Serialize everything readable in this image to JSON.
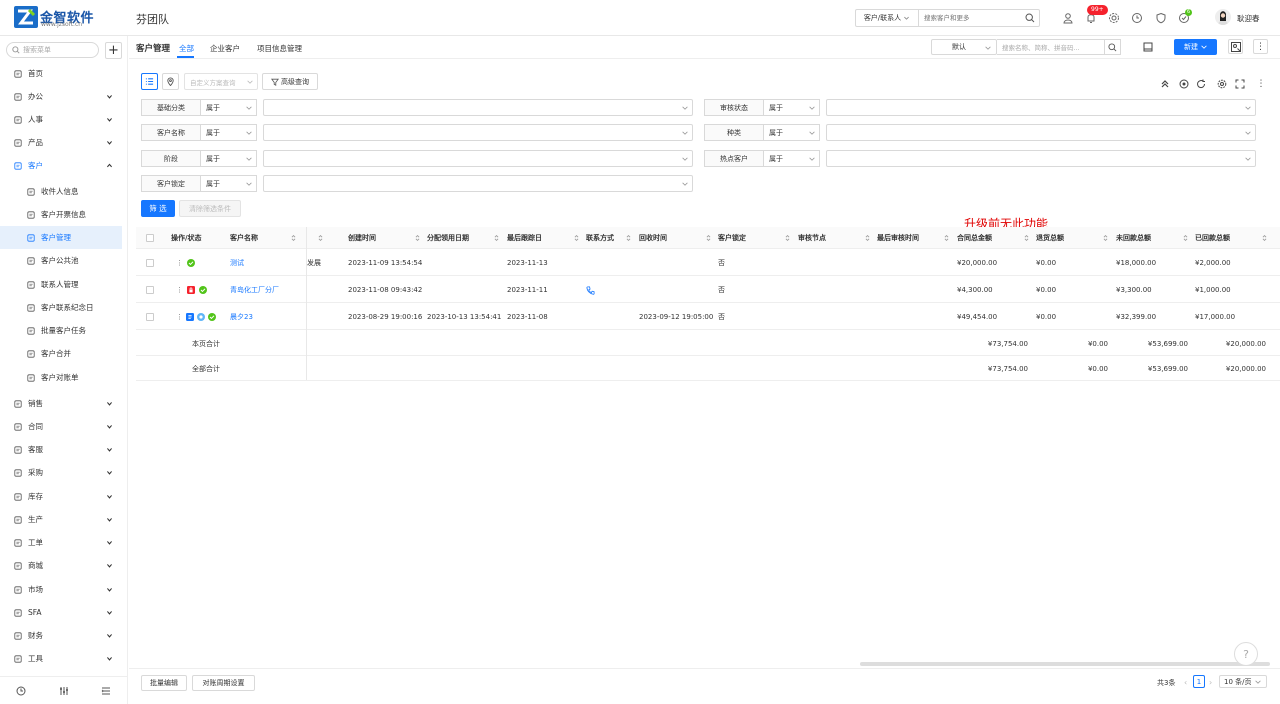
{
  "header": {
    "brand": "金智软件",
    "brand_url": "www.jzsoft.cn",
    "team": "芬团队",
    "search_scope": "客户/联系人",
    "search_placeholder": "搜索客户和更多",
    "notif_badge": "99+",
    "small_badge": "6",
    "user_name": "耿迎春"
  },
  "sidebar": {
    "search_placeholder": "搜索菜单",
    "items": [
      {
        "label": "首页",
        "icon": "home-icon"
      },
      {
        "label": "办公",
        "icon": "office-icon"
      },
      {
        "label": "人事",
        "icon": "person-icon"
      },
      {
        "label": "产品",
        "icon": "product-icon"
      },
      {
        "label": "客户",
        "icon": "customer-icon"
      },
      {
        "label": "收件人信息",
        "icon": "recipient-icon"
      },
      {
        "label": "客户开票信息",
        "icon": "invoice-icon"
      },
      {
        "label": "客户管理",
        "icon": "customer-manage-icon"
      },
      {
        "label": "客户公共池",
        "icon": "pool-icon"
      },
      {
        "label": "联系人管理",
        "icon": "contact-icon"
      },
      {
        "label": "客户联系纪念日",
        "icon": "calendar-icon"
      },
      {
        "label": "批量客户任务",
        "icon": "batch-task-icon"
      },
      {
        "label": "客户合并",
        "icon": "merge-icon"
      },
      {
        "label": "客户对账单",
        "icon": "statement-icon"
      },
      {
        "label": "销售",
        "icon": "sales-icon"
      },
      {
        "label": "合同",
        "icon": "contract-icon"
      },
      {
        "label": "客服",
        "icon": "service-icon"
      },
      {
        "label": "采购",
        "icon": "purchase-icon"
      },
      {
        "label": "库存",
        "icon": "stock-icon"
      },
      {
        "label": "生产",
        "icon": "production-icon"
      },
      {
        "label": "工单",
        "icon": "ticket-icon"
      },
      {
        "label": "商城",
        "icon": "mall-icon"
      },
      {
        "label": "市场",
        "icon": "market-icon"
      },
      {
        "label": "SFA",
        "icon": "sfa-icon"
      },
      {
        "label": "财务",
        "icon": "finance-icon"
      },
      {
        "label": "工具",
        "icon": "tools-icon"
      }
    ]
  },
  "subheader": {
    "title": "客户管理",
    "tabs": [
      "全部",
      "企业客户",
      "项目信息管理"
    ],
    "view": "默认",
    "keyword_placeholder": "搜索名称、简称、拼音码...",
    "new_label": "新建"
  },
  "filters": {
    "plan_placeholder": "自定义方案查询",
    "advanced_label": "高级查询",
    "rows": [
      {
        "label": "基础分类",
        "op": "属于"
      },
      {
        "label": "审核状态",
        "op": "属于"
      },
      {
        "label": "客户名称",
        "op": "属于"
      },
      {
        "label": "种类",
        "op": "属于"
      },
      {
        "label": "阶段",
        "op": "属于"
      },
      {
        "label": "热点客户",
        "op": "属于"
      },
      {
        "label": "客户锁定",
        "op": "属于"
      }
    ],
    "filter_btn": "筛 选",
    "clear_btn": "清除筛选条件"
  },
  "upgrade_note": "升级前无此功能",
  "table": {
    "columns": [
      "操作/状态",
      "客户名称",
      "创建时间",
      "分配领用日期",
      "最后跟踪日",
      "联系方式",
      "回收时间",
      "客户锁定",
      "审核节点",
      "最后审核时间",
      "合同总金额",
      "退货总额",
      "未回款总额",
      "已回款总额"
    ],
    "rows": [
      {
        "name": "测试",
        "partial": "发展",
        "created": "2023-11-09 13:54:54",
        "assigned": "",
        "last_track": "2023-11-13",
        "recycle": "",
        "locked": "否",
        "contract": "¥20,000.00",
        "returns": "¥0.00",
        "unpaid": "¥18,000.00",
        "paid": "¥2,000.00"
      },
      {
        "name": "青岛化工厂分厂",
        "partial": "",
        "created": "2023-11-08 09:43:42",
        "assigned": "",
        "last_track": "2023-11-11",
        "recycle": "",
        "locked": "否",
        "contract": "¥4,300.00",
        "returns": "¥0.00",
        "unpaid": "¥3,300.00",
        "paid": "¥1,000.00"
      },
      {
        "name": "晨夕23",
        "partial": "",
        "created": "2023-08-29 19:00:16",
        "assigned": "2023-10-13 13:54:41",
        "last_track": "2023-11-08",
        "recycle": "2023-09-12 19:05:00",
        "locked": "否",
        "contract": "¥49,454.00",
        "returns": "¥0.00",
        "unpaid": "¥32,399.00",
        "paid": "¥17,000.00"
      }
    ],
    "page_total": {
      "label": "本页合计",
      "contract": "¥73,754.00",
      "returns": "¥0.00",
      "unpaid": "¥53,699.00",
      "paid": "¥20,000.00"
    },
    "all_total": {
      "label": "全部合计",
      "contract": "¥73,754.00",
      "returns": "¥0.00",
      "unpaid": "¥53,699.00",
      "paid": "¥20,000.00"
    }
  },
  "footer": {
    "batch_edit": "批量编辑",
    "period_setting": "对账周期设置",
    "total": "共3条",
    "page": "1",
    "page_size": "10 条/页"
  },
  "colors": {
    "accent": "#1677ff",
    "danger": "#f5222d",
    "success": "#52c41a",
    "note": "#e00000"
  }
}
